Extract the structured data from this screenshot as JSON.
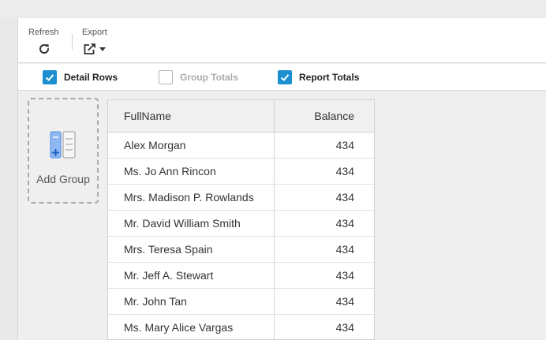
{
  "toolbar": {
    "refresh_label": "Refresh",
    "export_label": "Export"
  },
  "options": {
    "detail_rows": {
      "label": "Detail Rows",
      "checked": true
    },
    "group_totals": {
      "label": "Group Totals",
      "checked": false
    },
    "report_totals": {
      "label": "Report Totals",
      "checked": true
    }
  },
  "add_group": {
    "label": "Add Group"
  },
  "grid": {
    "columns": [
      "FullName",
      "Balance"
    ],
    "rows": [
      {
        "name": "Alex Morgan",
        "balance": "434"
      },
      {
        "name": "Ms. Jo Ann Rincon",
        "balance": "434"
      },
      {
        "name": "Mrs. Madison P. Rowlands",
        "balance": "434"
      },
      {
        "name": "Mr. David William Smith",
        "balance": "434"
      },
      {
        "name": "Mrs. Teresa Spain",
        "balance": "434"
      },
      {
        "name": "Mr. Jeff A. Stewart",
        "balance": "434"
      },
      {
        "name": "Mr. John Tan",
        "balance": "434"
      },
      {
        "name": "Ms. Mary Alice Vargas",
        "balance": "434"
      }
    ]
  },
  "colors": {
    "accent": "#1b8fd0",
    "icon_blue": "#4a8fe7"
  },
  "icons": [
    "refresh-icon",
    "export-icon",
    "dropdown-arrow-icon",
    "checkmark-icon",
    "add-group-icon"
  ]
}
